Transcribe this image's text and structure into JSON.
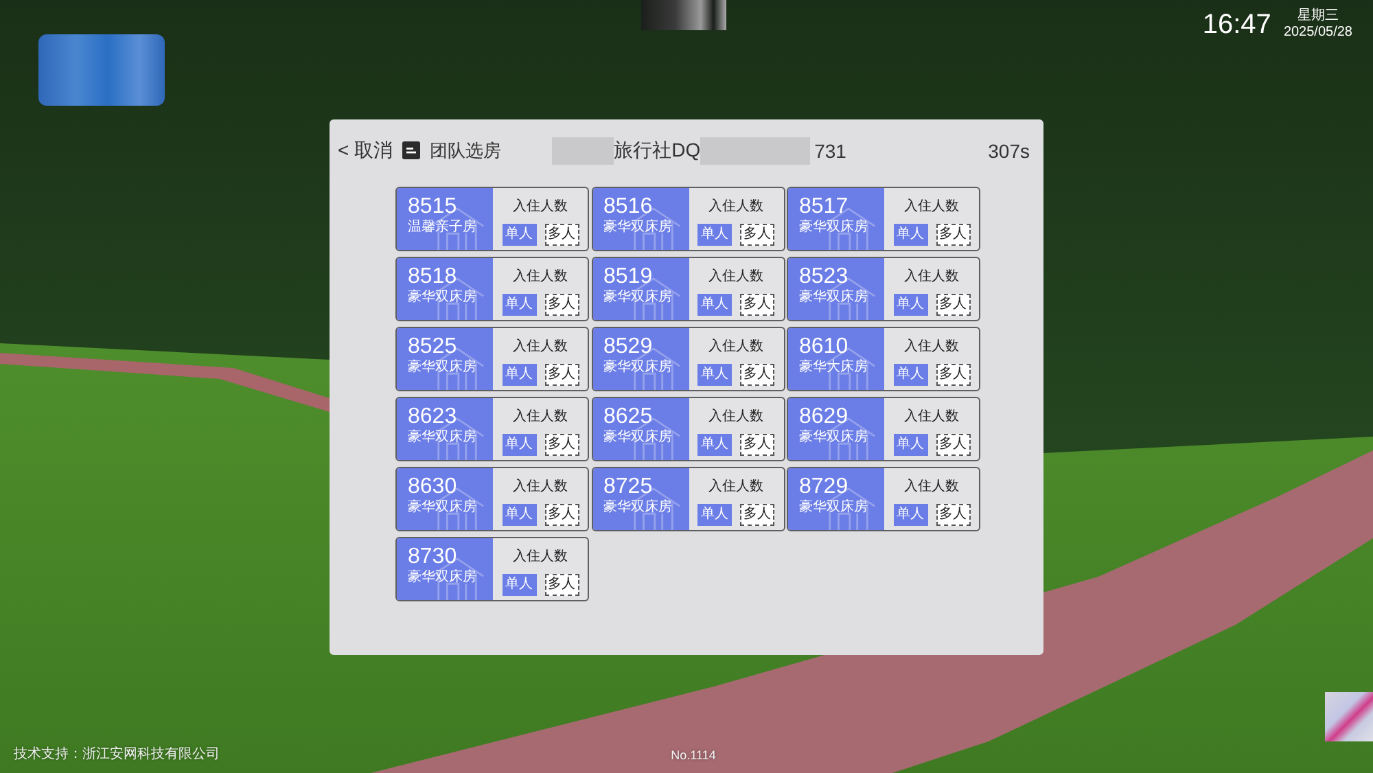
{
  "status": {
    "time": "16:47",
    "weekday": "星期三",
    "date": "2025/05/28"
  },
  "panel": {
    "back": "< 取消",
    "title": "团队选房",
    "group_name": "旅行社DQ",
    "group_code": "731",
    "countdown": "307s"
  },
  "rooms": [
    {
      "number": "8515",
      "type": "温馨亲子房",
      "occupancy_label": "入住人数",
      "options": [
        {
          "label": "单人",
          "selected": true
        },
        {
          "label": "多人",
          "selected": false
        }
      ]
    },
    {
      "number": "8516",
      "type": "豪华双床房",
      "occupancy_label": "入住人数",
      "options": [
        {
          "label": "单人",
          "selected": true
        },
        {
          "label": "多人",
          "selected": false
        }
      ]
    },
    {
      "number": "8517",
      "type": "豪华双床房",
      "occupancy_label": "入住人数",
      "options": [
        {
          "label": "单人",
          "selected": true
        },
        {
          "label": "多人",
          "selected": false
        }
      ]
    },
    {
      "number": "8518",
      "type": "豪华双床房",
      "occupancy_label": "入住人数",
      "options": [
        {
          "label": "单人",
          "selected": true
        },
        {
          "label": "多人",
          "selected": false
        }
      ]
    },
    {
      "number": "8519",
      "type": "豪华双床房",
      "occupancy_label": "入住人数",
      "options": [
        {
          "label": "单人",
          "selected": true
        },
        {
          "label": "多人",
          "selected": false
        }
      ]
    },
    {
      "number": "8523",
      "type": "豪华双床房",
      "occupancy_label": "入住人数",
      "options": [
        {
          "label": "单人",
          "selected": true
        },
        {
          "label": "多人",
          "selected": false
        }
      ]
    },
    {
      "number": "8525",
      "type": "豪华双床房",
      "occupancy_label": "入住人数",
      "options": [
        {
          "label": "单人",
          "selected": true
        },
        {
          "label": "多人",
          "selected": false
        }
      ]
    },
    {
      "number": "8529",
      "type": "豪华双床房",
      "occupancy_label": "入住人数",
      "options": [
        {
          "label": "单人",
          "selected": true
        },
        {
          "label": "多人",
          "selected": false
        }
      ]
    },
    {
      "number": "8610",
      "type": "豪华大床房",
      "occupancy_label": "入住人数",
      "options": [
        {
          "label": "单人",
          "selected": true
        },
        {
          "label": "多人",
          "selected": false
        }
      ]
    },
    {
      "number": "8623",
      "type": "豪华双床房",
      "occupancy_label": "入住人数",
      "options": [
        {
          "label": "单人",
          "selected": true
        },
        {
          "label": "多人",
          "selected": false
        }
      ]
    },
    {
      "number": "8625",
      "type": "豪华双床房",
      "occupancy_label": "入住人数",
      "options": [
        {
          "label": "单人",
          "selected": true
        },
        {
          "label": "多人",
          "selected": false
        }
      ]
    },
    {
      "number": "8629",
      "type": "豪华双床房",
      "occupancy_label": "入住人数",
      "options": [
        {
          "label": "单人",
          "selected": true
        },
        {
          "label": "多人",
          "selected": false
        }
      ]
    },
    {
      "number": "8630",
      "type": "豪华双床房",
      "occupancy_label": "入住人数",
      "options": [
        {
          "label": "单人",
          "selected": true
        },
        {
          "label": "多人",
          "selected": false
        }
      ]
    },
    {
      "number": "8725",
      "type": "豪华双床房",
      "occupancy_label": "入住人数",
      "options": [
        {
          "label": "单人",
          "selected": true
        },
        {
          "label": "多人",
          "selected": false
        }
      ]
    },
    {
      "number": "8729",
      "type": "豪华双床房",
      "occupancy_label": "入住人数",
      "options": [
        {
          "label": "单人",
          "selected": true
        },
        {
          "label": "多人",
          "selected": false
        }
      ]
    },
    {
      "number": "8730",
      "type": "豪华双床房",
      "occupancy_label": "入住人数",
      "options": [
        {
          "label": "单人",
          "selected": true
        },
        {
          "label": "多人",
          "selected": false
        }
      ]
    }
  ],
  "footer": {
    "support": "技术支持：浙江安网科技有限公司",
    "device_no": "No.1114"
  }
}
